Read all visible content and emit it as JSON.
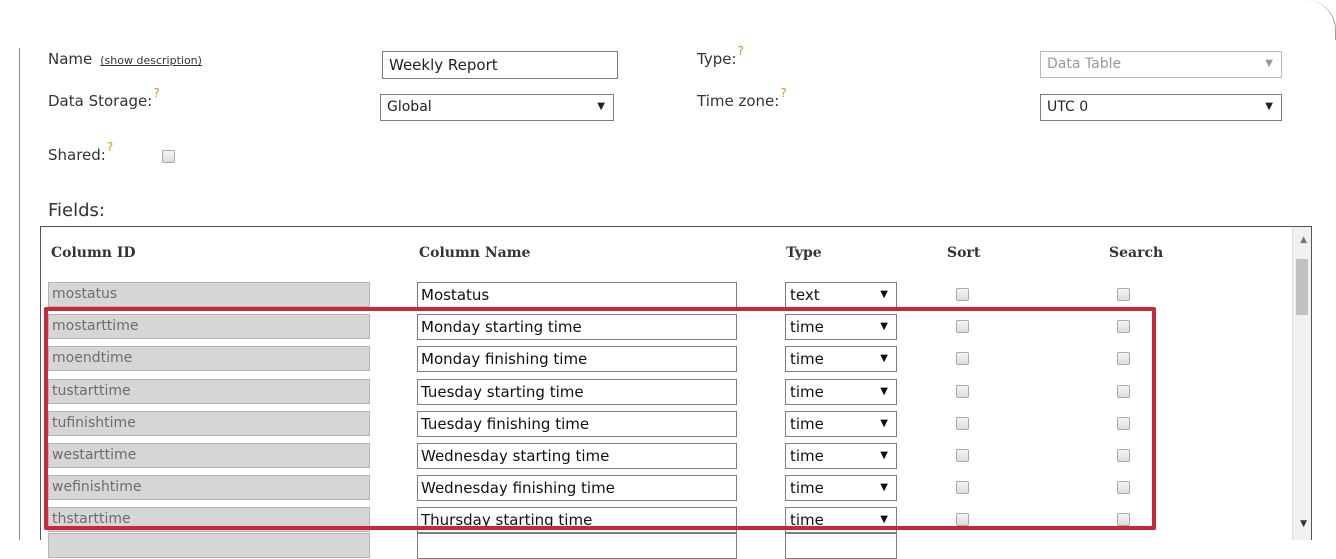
{
  "form": {
    "name_label": "Name",
    "show_description": "(show description)",
    "name_value": "Weekly Report",
    "type_label": "Type:",
    "type_value": "Data Table",
    "storage_label": "Data Storage:",
    "storage_value": "Global",
    "timezone_label": "Time zone:",
    "timezone_value": "UTC 0",
    "shared_label": "Shared:",
    "help_mark": "?"
  },
  "fields": {
    "title": "Fields:",
    "headers": {
      "column_id": "Column ID",
      "column_name": "Column Name",
      "type": "Type",
      "sort": "Sort",
      "search": "Search"
    },
    "rows": [
      {
        "id": "mostatus",
        "name": "Mostatus",
        "type": "text"
      },
      {
        "id": "mostarttime",
        "name": "Monday starting time",
        "type": "time"
      },
      {
        "id": "moendtime",
        "name": "Monday finishing time",
        "type": "time"
      },
      {
        "id": "tustarttime",
        "name": "Tuesday starting time",
        "type": "time"
      },
      {
        "id": "tufinishtime",
        "name": "Tuesday finishing time",
        "type": "time"
      },
      {
        "id": "westarttime",
        "name": "Wednesday starting time",
        "type": "time"
      },
      {
        "id": "wefinishtime",
        "name": "Wednesday finishing time",
        "type": "time"
      },
      {
        "id": "thstarttime",
        "name": "Thursday starting time",
        "type": "time"
      }
    ]
  },
  "colors": {
    "highlight": "#c8283a",
    "help_mark": "#d9901f",
    "readonly_field": "#d6d6d6"
  },
  "icons": {
    "dropdown": "triangle-down",
    "scroll_up": "triangle-up",
    "scroll_down": "triangle-down"
  }
}
